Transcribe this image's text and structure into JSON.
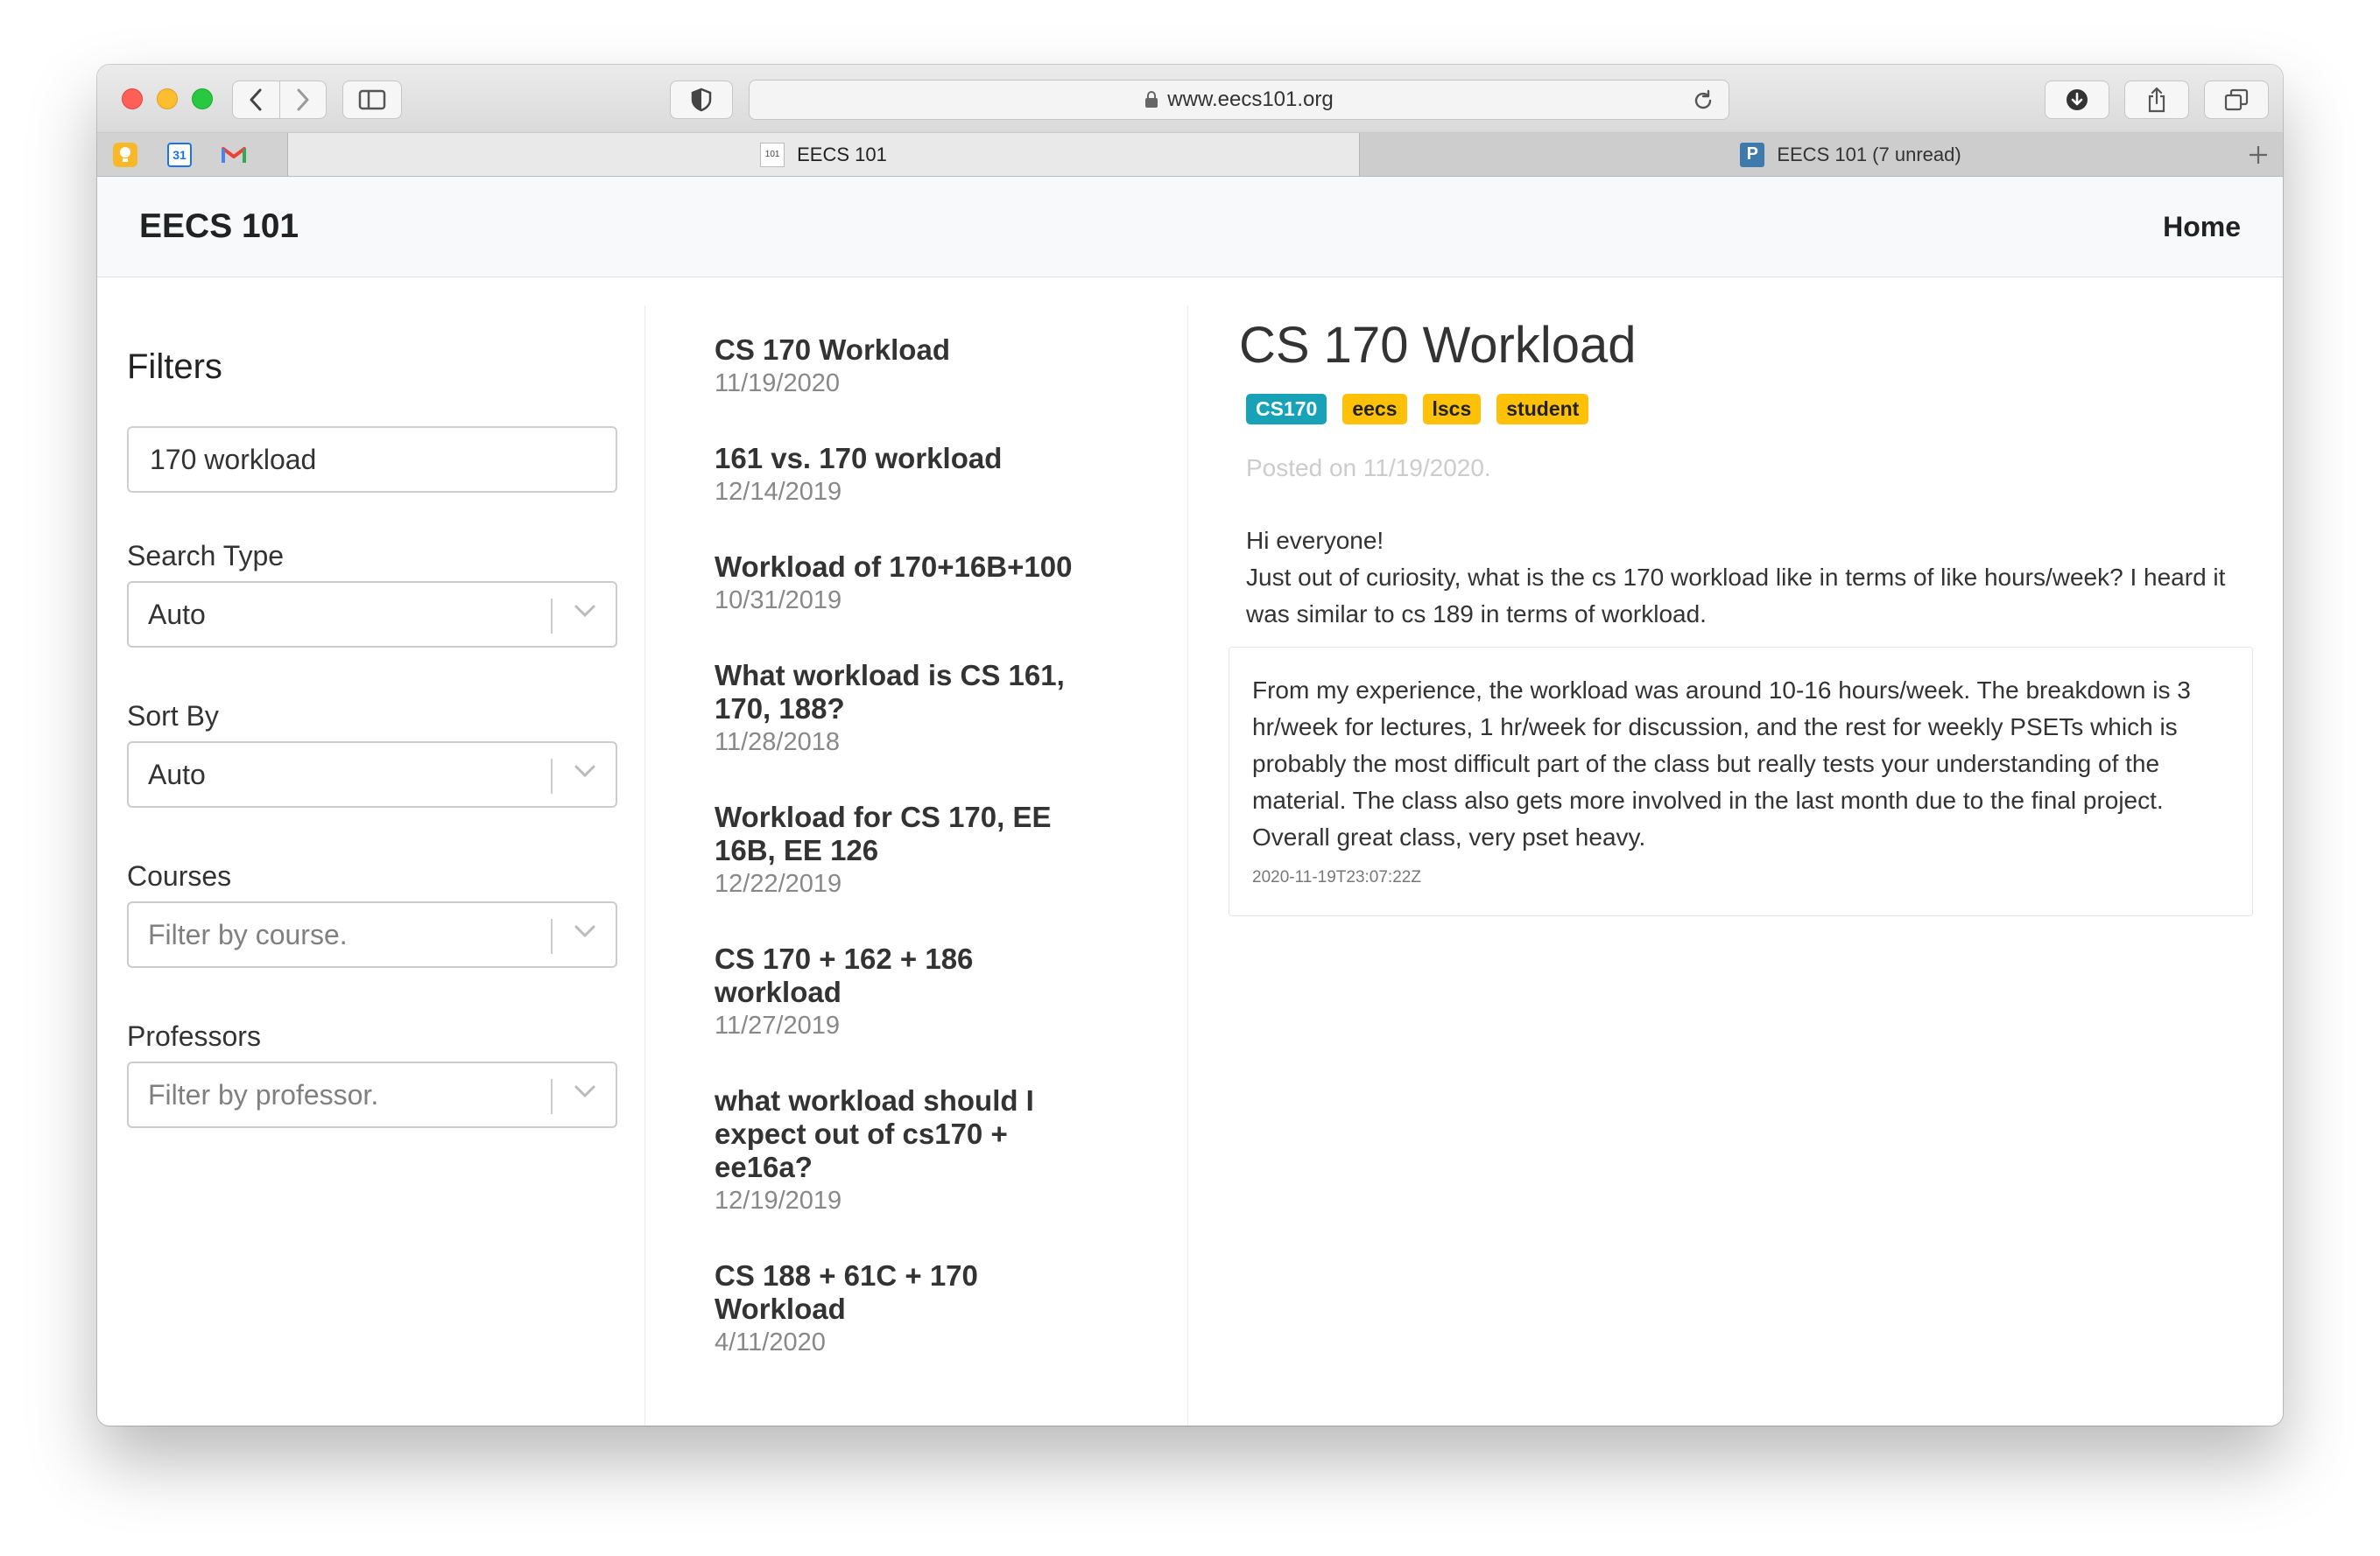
{
  "browser": {
    "address": "www.eecs101.org",
    "tabs": [
      {
        "label": "EECS 101",
        "icon": "101"
      },
      {
        "label": "EECS 101 (7 unread)",
        "icon": "P"
      }
    ],
    "favorites": [
      {
        "name": "bulb-icon",
        "label": ""
      },
      {
        "name": "calendar-icon",
        "label": "31"
      },
      {
        "name": "gmail-icon",
        "label": "M"
      }
    ]
  },
  "navbar": {
    "brand": "EECS 101",
    "home": "Home"
  },
  "filters": {
    "heading": "Filters",
    "search_value": "170 workload",
    "search_type_label": "Search Type",
    "search_type_value": "Auto",
    "sort_by_label": "Sort By",
    "sort_by_value": "Auto",
    "courses_label": "Courses",
    "courses_placeholder": "Filter by course.",
    "professors_label": "Professors",
    "professors_placeholder": "Filter by professor."
  },
  "results": [
    {
      "title": "CS 170 Workload",
      "date": "11/19/2020"
    },
    {
      "title": "161 vs. 170 workload",
      "date": "12/14/2019"
    },
    {
      "title": "Workload of 170+16B+100",
      "date": "10/31/2019"
    },
    {
      "title": "What workload is CS 161, 170, 188?",
      "date": "11/28/2018"
    },
    {
      "title": "Workload for CS 170, EE 16B, EE 126",
      "date": "12/22/2019"
    },
    {
      "title": "CS 170 + 162 + 186 workload",
      "date": "11/27/2019"
    },
    {
      "title": "what workload should I expect out of cs170 + ee16a?",
      "date": "12/19/2019"
    },
    {
      "title": "CS 188 + 61C + 170 Workload",
      "date": "4/11/2020"
    }
  ],
  "post": {
    "title": "CS 170 Workload",
    "tags": [
      {
        "label": "CS170",
        "color": "#17a2b8"
      },
      {
        "label": "eecs",
        "color": "#ffc107"
      },
      {
        "label": "lscs",
        "color": "#ffc107"
      },
      {
        "label": "student",
        "color": "#ffc107"
      }
    ],
    "posted": "Posted on 11/19/2020.",
    "body_line1": "Hi everyone!",
    "body_line2": "Just out of curiosity, what is the cs 170 workload like in terms of like hours/week? I heard it was similar to cs 189 in terms of workload.",
    "answer_text": "From my experience, the workload was around 10-16 hours/week. The breakdown is 3 hr/week for lectures, 1 hr/week for discussion, and the rest for weekly PSETs which is probably the most difficult part of the class but really tests your understanding of the material. The class also gets more involved in the last month due to the final project. Overall great class, very pset heavy.",
    "answer_timestamp": "2020-11-19T23:07:22Z"
  }
}
